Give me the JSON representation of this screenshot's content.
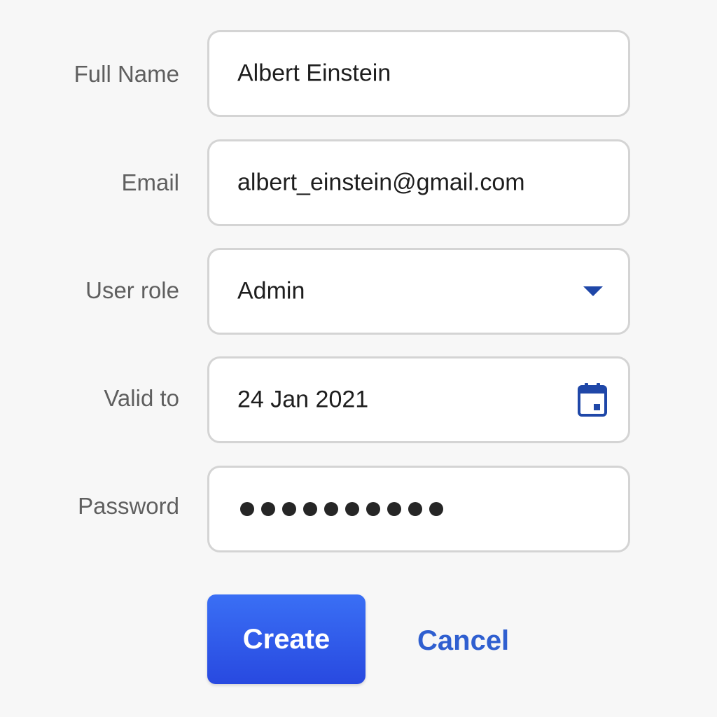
{
  "form": {
    "fields": [
      {
        "label": "Full Name",
        "value": "Albert Einstein"
      },
      {
        "label": "Email",
        "value": "albert_einstein@gmail.com"
      },
      {
        "label": "User role",
        "value": "Admin"
      },
      {
        "label": "Valid to",
        "value": "24 Jan 2021"
      },
      {
        "label": "Password",
        "masked_length": 10
      }
    ]
  },
  "actions": {
    "create_label": "Create",
    "cancel_label": "Cancel"
  },
  "icons": {
    "role_dropdown": "chevron-down-icon",
    "valid_to": "calendar-icon"
  },
  "colors": {
    "accent": "#2f5fd0",
    "button_top": "#3a6ff5",
    "button_bottom": "#2849e0",
    "icon": "#1f47a8"
  }
}
